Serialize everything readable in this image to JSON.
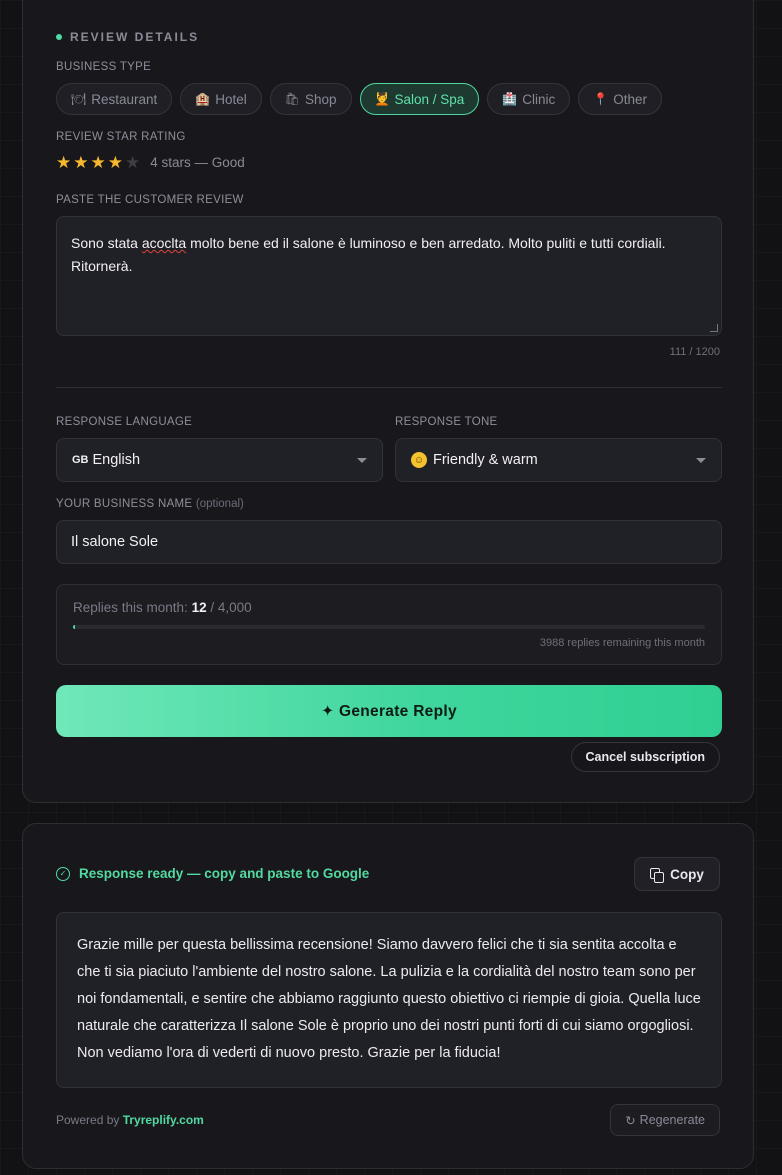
{
  "review_details": {
    "section_title": "REVIEW DETAILS",
    "business_type_label": "BUSINESS TYPE",
    "business_types": [
      {
        "icon": "🍽",
        "label": "Restaurant",
        "active": false
      },
      {
        "icon": "🏨",
        "label": "Hotel",
        "active": false
      },
      {
        "icon": "🛍",
        "label": "Shop",
        "active": false
      },
      {
        "icon": "💆",
        "label": "Salon / Spa",
        "active": true
      },
      {
        "icon": "🏥",
        "label": "Clinic",
        "active": false
      },
      {
        "icon": "📍",
        "label": "Other",
        "active": false
      }
    ],
    "rating_label": "REVIEW STAR RATING",
    "rating_value": 4,
    "rating_max": 5,
    "rating_caption": "4 stars — Good",
    "review_label": "PASTE THE CUSTOMER REVIEW",
    "review_text_before": "Sono stata ",
    "review_text_misspelled": "acoclta",
    "review_text_after": " molto bene ed il salone è luminoso e ben arredato. Molto puliti e tutti cordiali. Ritornerà.",
    "char_count": "111 / 1200"
  },
  "settings": {
    "language_label": "RESPONSE LANGUAGE",
    "language_flag": "GB",
    "language_value": "English",
    "tone_label": "RESPONSE TONE",
    "tone_value": "Friendly & warm",
    "business_name_label": "YOUR BUSINESS NAME",
    "business_name_optional": "(optional)",
    "business_name_value": "Il salone Sole"
  },
  "usage": {
    "label": "Replies this month:",
    "used": "12",
    "separator": " / ",
    "limit": "4,000",
    "used_fraction": 0.003,
    "remaining_text": "3988 replies remaining this month"
  },
  "actions": {
    "generate_label": "✦ Generate Reply",
    "cancel_label": "Cancel subscription"
  },
  "response": {
    "status": "Response ready — copy and paste to Google",
    "copy_label": "Copy",
    "reply_text": "Grazie mille per questa bellissima recensione! Siamo davvero felici che ti sia sentita accolta e che ti sia piaciuto l'ambiente del nostro salone. La pulizia e la cordialità del nostro team sono per noi fondamentali, e sentire che abbiamo raggiunto questo obiettivo ci riempie di gioia. Quella luce naturale che caratterizza Il salone Sole è proprio uno dei nostri punti forti di cui siamo orgogliosi. Non vediamo l'ora di vederti di nuovo presto. Grazie per la fiducia!",
    "powered_prefix": "Powered by ",
    "powered_link": "Tryreplify.com",
    "regenerate_label": "Regenerate"
  },
  "colors": {
    "accent": "#4fdca4",
    "star": "#f5b82e",
    "background": "#121215",
    "card": "#18181c"
  }
}
